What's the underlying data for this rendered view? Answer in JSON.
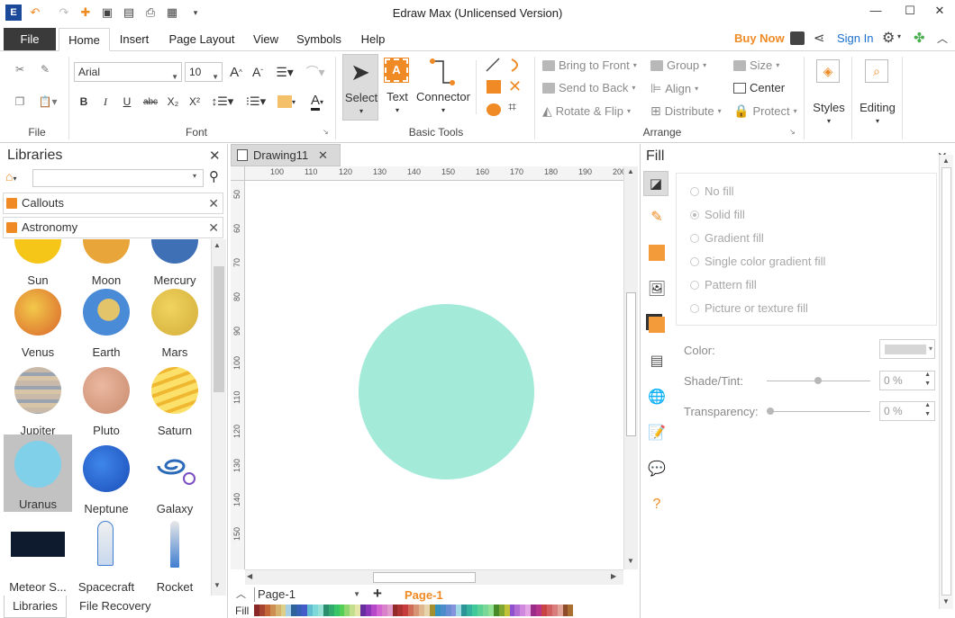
{
  "window": {
    "title": "Edraw Max (Unlicensed Version)",
    "min": "—",
    "max": "☐",
    "close": "✕"
  },
  "quick_access": [
    "logo-icon",
    "undo-icon",
    "redo-icon",
    "new-icon",
    "open-icon",
    "save-icon",
    "print-icon",
    "export-icon",
    "customize-icon"
  ],
  "menu": {
    "file": "File",
    "tabs": [
      "Home",
      "Insert",
      "Page Layout",
      "View",
      "Symbols",
      "Help"
    ],
    "active_tab": "Home",
    "buy_now": "Buy Now",
    "sign_in": "Sign In"
  },
  "ribbon": {
    "file_group": "File",
    "font_group": "Font",
    "font_name": "Arial",
    "font_size": "10",
    "basic_tools_group": "Basic Tools",
    "select_label": "Select",
    "text_label": "Text",
    "connector_label": "Connector",
    "arrange_group": "Arrange",
    "bring_to_front": "Bring to Front",
    "send_to_back": "Send to Back",
    "rotate_flip": "Rotate & Flip",
    "group": "Group",
    "align": "Align",
    "distribute": "Distribute",
    "size": "Size",
    "center": "Center",
    "protect": "Protect",
    "styles_label": "Styles",
    "editing_label": "Editing"
  },
  "libraries": {
    "title": "Libraries",
    "search_placeholder": "",
    "categories": [
      "Callouts",
      "Astronomy"
    ],
    "shapes": [
      {
        "label": "Sun",
        "color": "#f5c518"
      },
      {
        "label": "Moon",
        "color": "#e8a53a"
      },
      {
        "label": "Mercury",
        "color": "#3f6fb5"
      },
      {
        "label": "Venus",
        "color": "#e8a53a"
      },
      {
        "label": "Earth",
        "color": "#4a8bd8"
      },
      {
        "label": "Mars",
        "color": "#e6c34d"
      },
      {
        "label": "Jupiter",
        "color": "#b8a89a"
      },
      {
        "label": "Pluto",
        "color": "#e0a98a"
      },
      {
        "label": "Saturn",
        "color": "#f8d44a"
      },
      {
        "label": "Uranus",
        "color": "#7fd0e8"
      },
      {
        "label": "Neptune",
        "color": "#1f5fcf"
      },
      {
        "label": "Galaxy",
        "color": "#2b6ab8"
      },
      {
        "label": "Meteor S...",
        "color": "#0e1a2e"
      },
      {
        "label": "Spacecraft",
        "color": "#3f7ed0"
      },
      {
        "label": "Rocket",
        "color": "#3f7ed0"
      }
    ],
    "selected": "Uranus",
    "bottom_tabs": [
      "Libraries",
      "File Recovery"
    ]
  },
  "document": {
    "tab": "Drawing11",
    "ruler_top": [
      "100",
      "110",
      "120",
      "130",
      "140",
      "150",
      "160",
      "170",
      "180",
      "190",
      "200"
    ],
    "ruler_left": [
      "50",
      "60",
      "70",
      "80",
      "90",
      "100",
      "110",
      "120",
      "130",
      "140",
      "150"
    ],
    "shape_color": "#a3ead9",
    "page_select": "Page-1",
    "active_page": "Page-1",
    "fill_label": "Fill"
  },
  "fill_panel": {
    "title": "Fill",
    "options": [
      "No fill",
      "Solid fill",
      "Gradient fill",
      "Single color gradient fill",
      "Pattern fill",
      "Picture or texture fill"
    ],
    "selected": "Solid fill",
    "color_label": "Color:",
    "shade_label": "Shade/Tint:",
    "shade_value": "0 %",
    "transparency_label": "Transparency:",
    "transparency_value": "0 %"
  },
  "colors": {
    "accent": "#f08a24",
    "sign_in": "#1a6fd0",
    "selected_shape_bg": "#c2c2c2"
  }
}
